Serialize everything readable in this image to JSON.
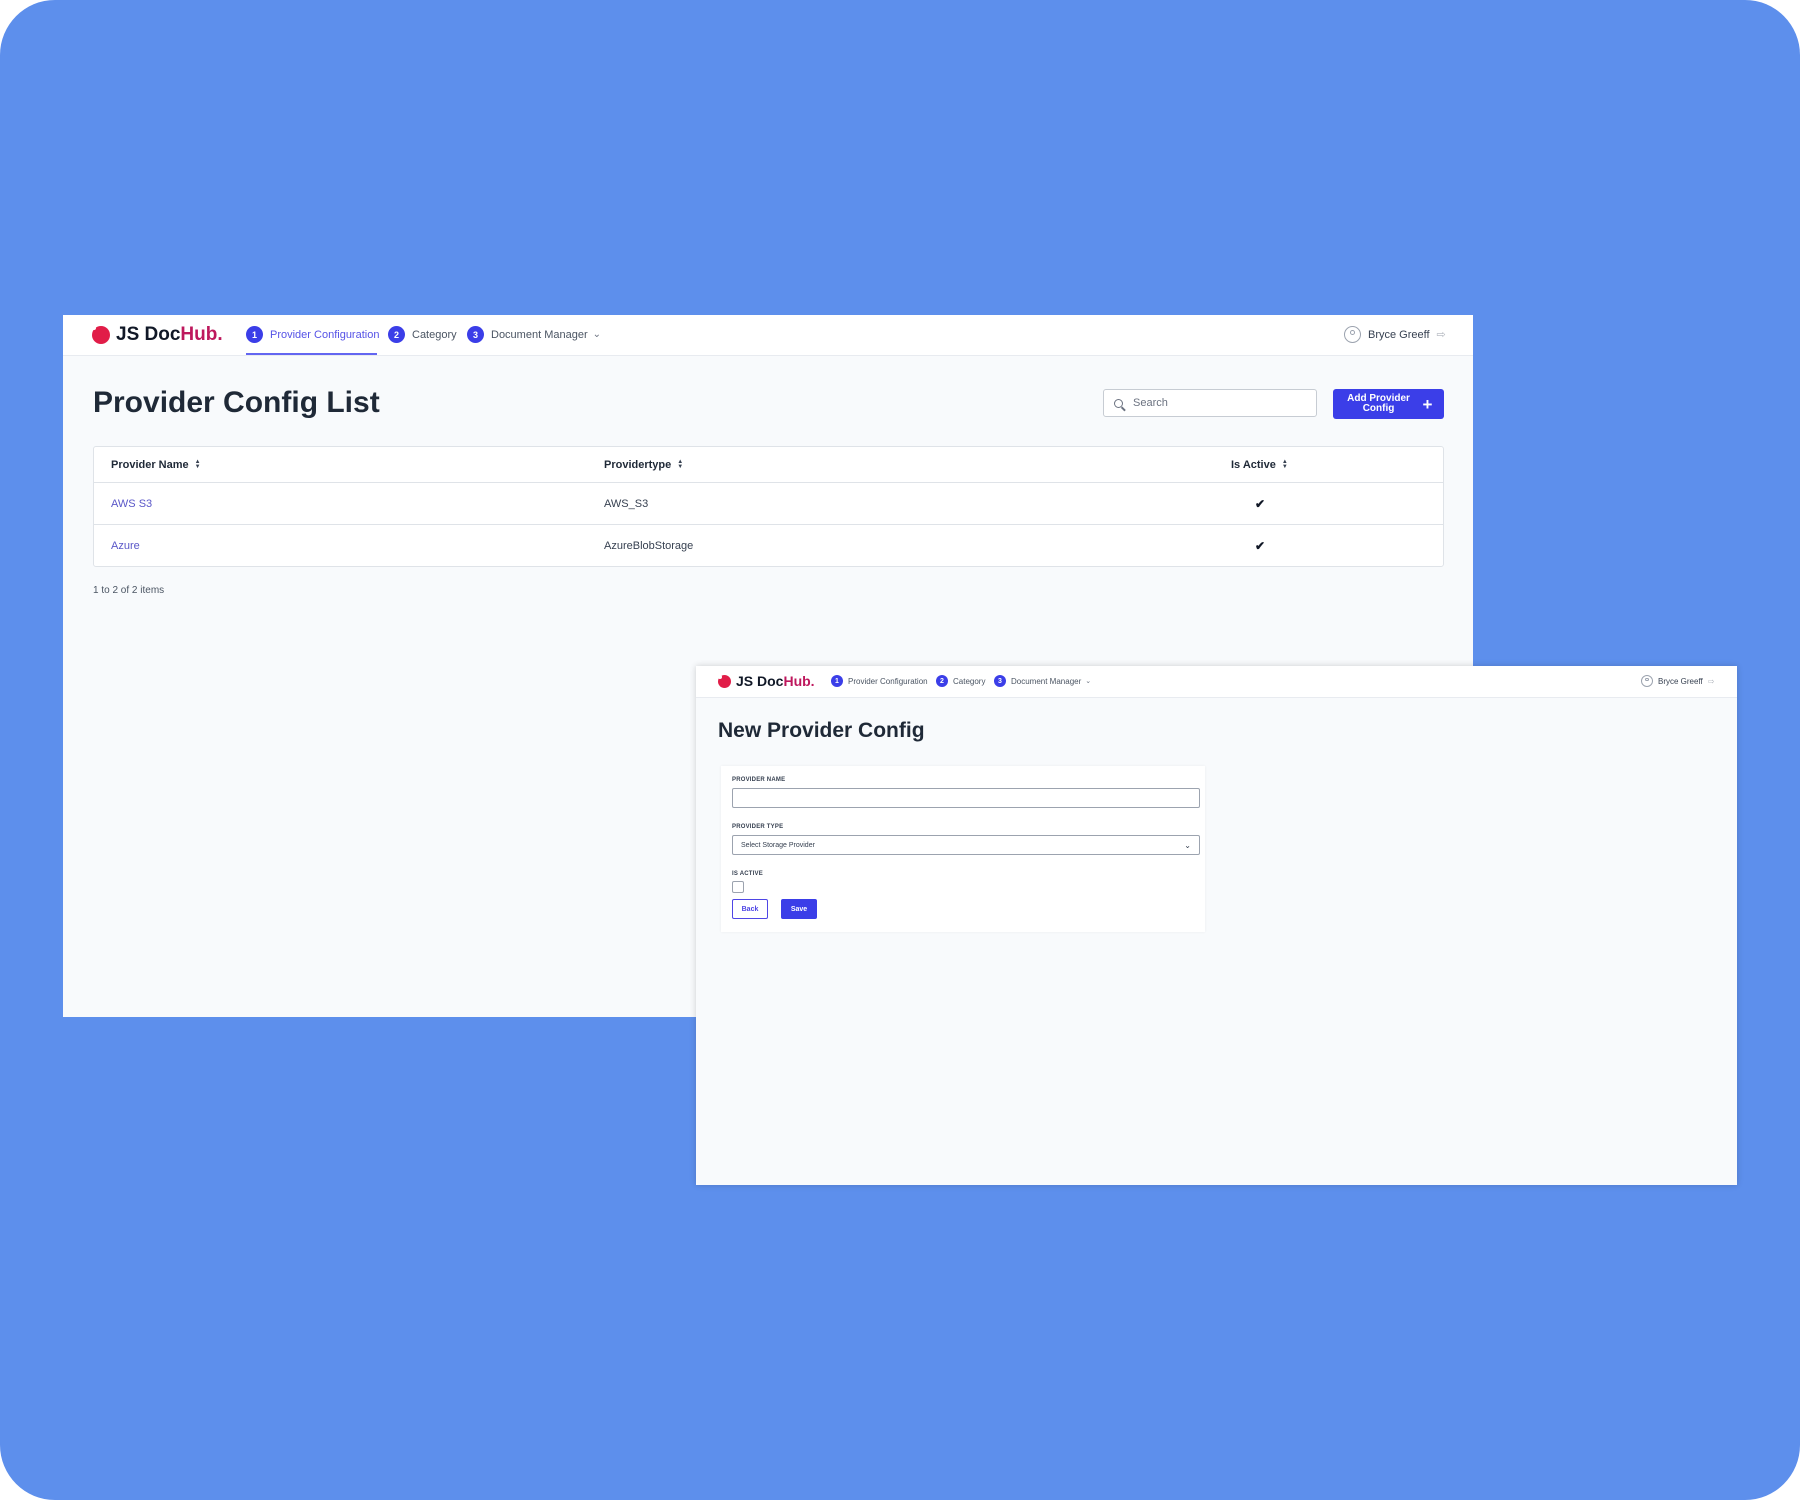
{
  "brand": {
    "prefix": "JS Doc",
    "suffix": "Hub."
  },
  "nav": {
    "items": [
      {
        "number": "1",
        "label": "Provider Configuration"
      },
      {
        "number": "2",
        "label": "Category"
      },
      {
        "number": "3",
        "label": "Document Manager"
      }
    ],
    "user_name": "Bryce Greeff"
  },
  "list_page": {
    "title": "Provider Config List",
    "search_placeholder": "Search",
    "add_button_label": "Add Provider Config",
    "add_button_icon": "+",
    "columns": [
      "Provider Name",
      "Providertype",
      "Is Active"
    ],
    "rows": [
      {
        "name": "AWS S3",
        "type": "AWS_S3",
        "active": "✔"
      },
      {
        "name": "Azure",
        "type": "AzureBlobStorage",
        "active": "✔"
      }
    ],
    "pagination": "1 to 2 of 2 items"
  },
  "form_page": {
    "title": "New Provider Config",
    "provider_name_label": "PROVIDER NAME",
    "provider_name_value": "",
    "provider_type_label": "PROVIDER TYPE",
    "provider_type_selected": "Select Storage Provider",
    "is_active_label": "IS ACTIVE",
    "is_active_checked": false,
    "back_label": "Back",
    "save_label": "Save"
  },
  "colors": {
    "background": "#5d8fec",
    "primary": "#3b3ee8",
    "brand_accent": "#e11d48",
    "link": "#5a57c8"
  }
}
